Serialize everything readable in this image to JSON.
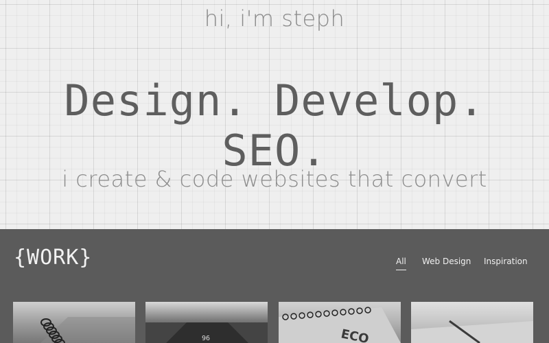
{
  "hero": {
    "greeting": "hi, i'm steph",
    "headline": "Design. Develop. SEO.",
    "tagline": "i create & code websites that convert"
  },
  "work": {
    "title": "{WORK}",
    "filters": [
      {
        "label": "All",
        "active": true
      },
      {
        "label": "Web Design",
        "active": false
      },
      {
        "label": "Inspiration",
        "active": false
      }
    ],
    "thumbnails": [
      {
        "subject": "spiral-notebook-photo"
      },
      {
        "subject": "road-photo",
        "visible_text": "96"
      },
      {
        "subject": "eco-notebook-photo",
        "visible_text": "ECO"
      },
      {
        "subject": "pencil-paper-photo"
      }
    ]
  },
  "colors": {
    "hero_background": "#efefef",
    "work_background": "#5b5b5b",
    "headline_text": "#5e5e5e",
    "light_text": "#8a8a8a"
  }
}
